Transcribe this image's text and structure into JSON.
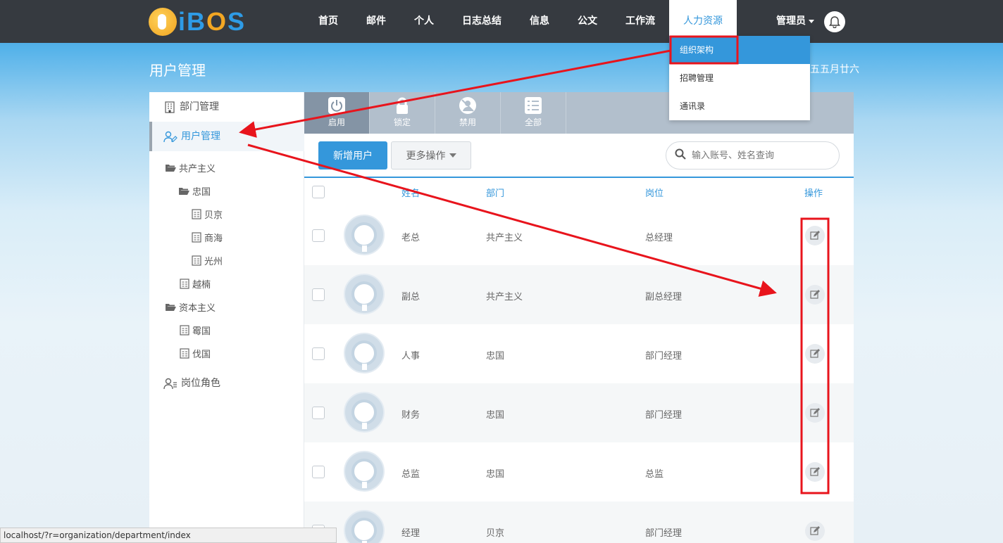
{
  "header": {
    "logo_text": "iBOS",
    "nav": [
      "首页",
      "邮件",
      "个人",
      "日志总结",
      "信息",
      "公文",
      "工作流",
      "人力资源"
    ],
    "active_nav": "人力资源",
    "admin_label": "管理员"
  },
  "dropdown": {
    "items": [
      "组织架构",
      "招聘管理",
      "通讯录"
    ],
    "selected": "组织架构"
  },
  "page": {
    "title": "用户管理",
    "date_text": "五五月廿六"
  },
  "sidebar": {
    "items": [
      "部门管理",
      "用户管理",
      "岗位角色"
    ],
    "selected": "用户管理",
    "tree": [
      "共产主义",
      "忠国",
      "贝京",
      "商海",
      "光州",
      "越楠",
      "资本主义",
      "霉国",
      "伐国"
    ]
  },
  "tabs": [
    "启用",
    "锁定",
    "禁用",
    "全部"
  ],
  "active_tab": "启用",
  "toolbar": {
    "add_label": "新增用户",
    "more_label": "更多操作",
    "search_placeholder": "输入账号、姓名查询"
  },
  "table": {
    "headers": [
      "姓名",
      "部门",
      "岗位",
      "操作"
    ],
    "rows": [
      {
        "name": "老总",
        "dept": "共产主义",
        "post": "总经理"
      },
      {
        "name": "副总",
        "dept": "共产主义",
        "post": "副总经理"
      },
      {
        "name": "人事",
        "dept": "忠国",
        "post": "部门经理"
      },
      {
        "name": "财务",
        "dept": "忠国",
        "post": "部门经理"
      },
      {
        "name": "总监",
        "dept": "忠国",
        "post": "总监"
      },
      {
        "name": "经理",
        "dept": "贝京",
        "post": "部门经理"
      }
    ]
  },
  "status_bar": "localhost/?r=organization/department/index",
  "colors": {
    "accent": "#3497db",
    "topbar": "#363a40",
    "annotation": "#e8141c"
  }
}
